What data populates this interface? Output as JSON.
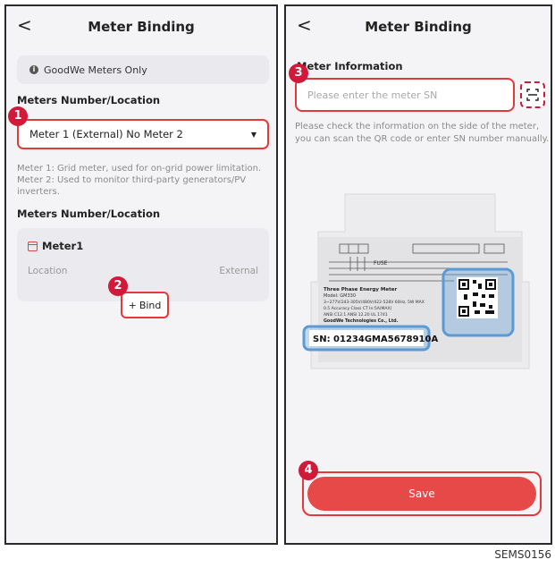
{
  "left": {
    "back": "<",
    "title": "Meter Binding",
    "info": "GoodWe Meters Only",
    "section1": "Meters Number/Location",
    "select_value": "Meter 1 (External) No Meter 2",
    "description": "Meter 1: Grid meter, used for on-grid power limitation. Meter 2: Used to monitor third-party generators/PV inverters.",
    "section2": "Meters Number/Location",
    "card": {
      "name": "Meter1",
      "location_label": "Location",
      "location_value": "External",
      "bind_label": "Bind"
    }
  },
  "right": {
    "back": "<",
    "title": "Meter Binding",
    "section": "Meter Information",
    "placeholder": "Please enter the meter SN",
    "hint": "Please check the information on the side of the meter, you can scan the QR code or enter SN number manually.",
    "device": {
      "product": "Three Phase Energy Meter",
      "model": "Model: GM330",
      "spec1": "3~277V/243-305V/480V/422-528V 60Hz, 5W MAX",
      "spec2": "0.5 Accuracy Class   CT In:5A(MAX)",
      "spec3": "ANSI C12.1  ANSI 12.20  UL 1741",
      "company": "GoodWe Technologies Co., Ltd.",
      "fuse": "FUSE",
      "sn": "SN: 01234GMA5678910A"
    },
    "save_label": "Save"
  },
  "markers": [
    "1",
    "2",
    "3",
    "4"
  ],
  "figure_code": "SEMS0156",
  "colors": {
    "accent": "#e74848",
    "outline": "#e23a3a",
    "marker": "#d11a3a",
    "highlight": "#5b9bd5"
  }
}
